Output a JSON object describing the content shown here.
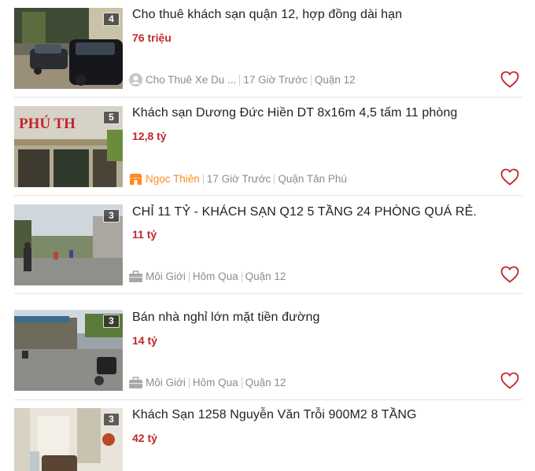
{
  "listings": [
    {
      "title": "Cho thuê khách sạn quận 12, hợp đồng dài hạn",
      "price": "76 triệu",
      "image_count": "4",
      "seller_type": "user-avatar-icon",
      "seller": "Cho Thuê Xe Du ...",
      "time": "17 Giờ Trước",
      "location": "Quận 12"
    },
    {
      "title": "Khách sạn Dương Đức Hiền DT 8x16m 4,5 tấm 11 phòng",
      "price": "12,8 tỷ",
      "image_count": "5",
      "seller_type": "shop-icon",
      "seller": "Ngọc Thiên",
      "time": "17 Giờ Trước",
      "location": "Quận Tân Phú",
      "sign_text": "PHÚ TH"
    },
    {
      "title": "CHỈ 11 TỶ - KHÁCH SẠN Q12 5 TẦNG 24 PHÒNG QUÁ RẺ.",
      "price": "11 tỷ",
      "image_count": "3",
      "seller_type": "briefcase-icon",
      "seller": "Môi Giới",
      "time": "Hôm Qua",
      "location": "Quận 12"
    },
    {
      "title": "Bán nhà nghỉ lớn mặt tiền đường",
      "price": "14 tỷ",
      "image_count": "3",
      "seller_type": "briefcase-icon",
      "seller": "Môi Giới",
      "time": "Hôm Qua",
      "location": "Quận 12"
    },
    {
      "title": "Khách Sạn 1258 Nguyễn Văn Trỗi 900M2 8 TẦNG",
      "price": "42 tỷ",
      "image_count": "3"
    }
  ],
  "colors": {
    "price": "#c0272d",
    "heart": "#c0272d",
    "shop_seller": "#ff8a1e",
    "meta_text": "#8c8c8c"
  }
}
